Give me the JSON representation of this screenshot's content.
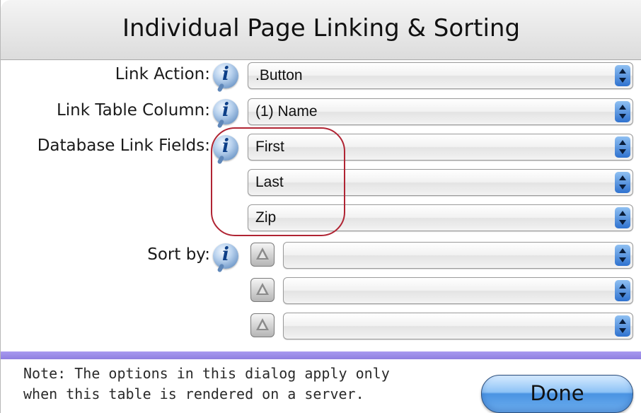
{
  "dialog": {
    "title": "Individual Page Linking & Sorting"
  },
  "fields": {
    "link_action": {
      "label": "Link Action:",
      "value": ".Button"
    },
    "link_table_column": {
      "label": "Link Table Column:",
      "value": "(1) Name"
    },
    "database_link_fields": {
      "label": "Database Link Fields:",
      "values": [
        "First",
        "Last",
        "Zip"
      ]
    },
    "sort_by": {
      "label": "Sort by:",
      "values": [
        "",
        "",
        ""
      ]
    }
  },
  "icons": {
    "info": "info-icon",
    "sort_direction": "sort-direction-icon",
    "popup_arrows": "popup-arrows-icon"
  },
  "footer": {
    "note_line1": "Note: The options in this dialog apply only",
    "note_line2": "when this table is rendered on a server.",
    "done_label": "Done"
  },
  "colors": {
    "highlight": "#b02433",
    "separator": "#9a8ae8",
    "done_button": "#6fb0f0"
  }
}
